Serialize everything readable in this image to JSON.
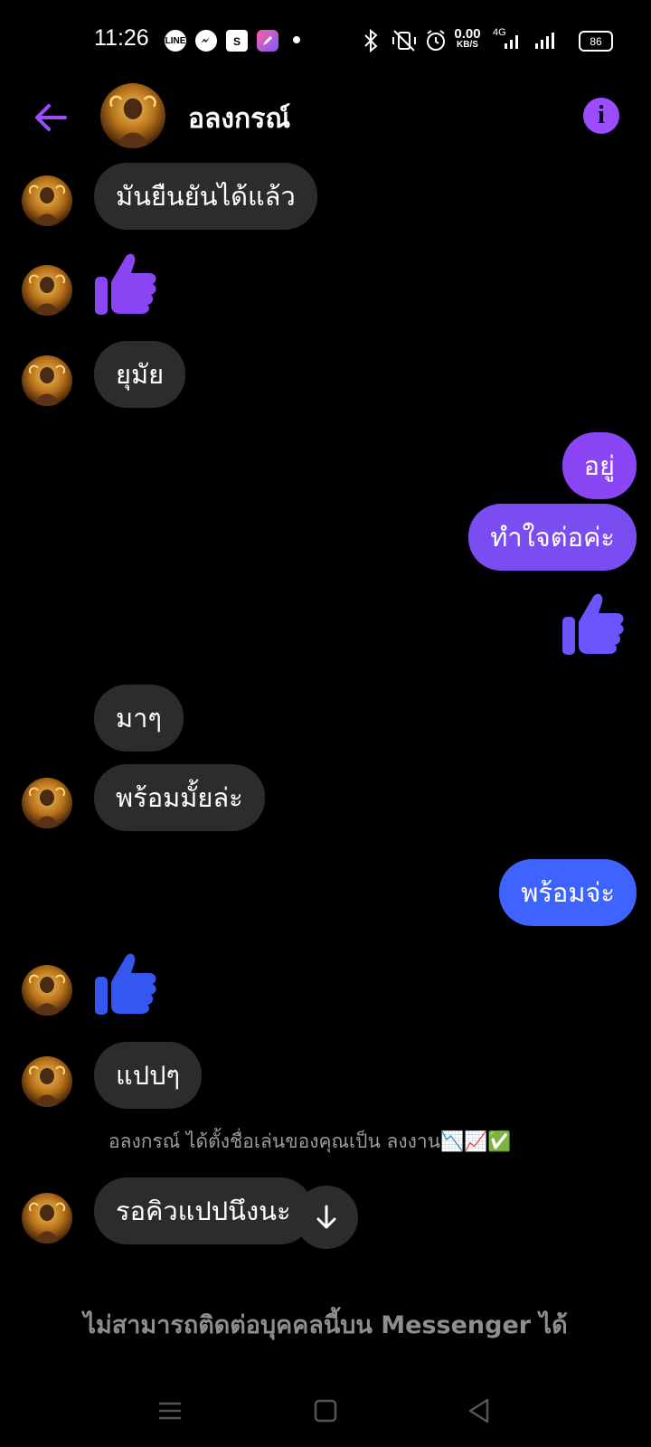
{
  "status_bar": {
    "time": "11:26",
    "app_icons": [
      "LINE",
      "messenger",
      "shopee",
      "pen-app",
      "dot"
    ],
    "data_rate": "0.00",
    "data_unit": "KB/S",
    "network": "4G",
    "battery": "86"
  },
  "header": {
    "name": "อลงกรณ์"
  },
  "messages": [
    {
      "side": "in",
      "text": "มันยืนยันได้แล้ว"
    },
    {
      "side": "in",
      "type": "like"
    },
    {
      "side": "in",
      "text": "ยุมัย"
    },
    {
      "side": "out",
      "text": "อยู่"
    },
    {
      "side": "out",
      "text": "ทำใจต่อค่ะ"
    },
    {
      "side": "out",
      "type": "like"
    },
    {
      "side": "in",
      "text": "มาๆ"
    },
    {
      "side": "in",
      "text": "พร้อมมั้ยล่ะ"
    },
    {
      "side": "out",
      "text": "พร้อมจ่ะ"
    },
    {
      "side": "in",
      "type": "like"
    },
    {
      "side": "in",
      "text": "แปปๆ"
    },
    {
      "side": "in",
      "text": "รอคิวแปปนึงนะ"
    }
  ],
  "system_note": "อลงกรณ์ ได้ตั้งชื่อเล่นของคุณเป็น ลงงาน📉📈✅",
  "blocked_notice": "ไม่สามารถติดต่อบุคคลนี้บน Messenger ได้",
  "colors": {
    "accent_purple": "#9b4dff",
    "bubble_purple": "#7a4df0",
    "bubble_blue": "#3f63ff",
    "incoming_bubble": "#2c2c2e"
  }
}
